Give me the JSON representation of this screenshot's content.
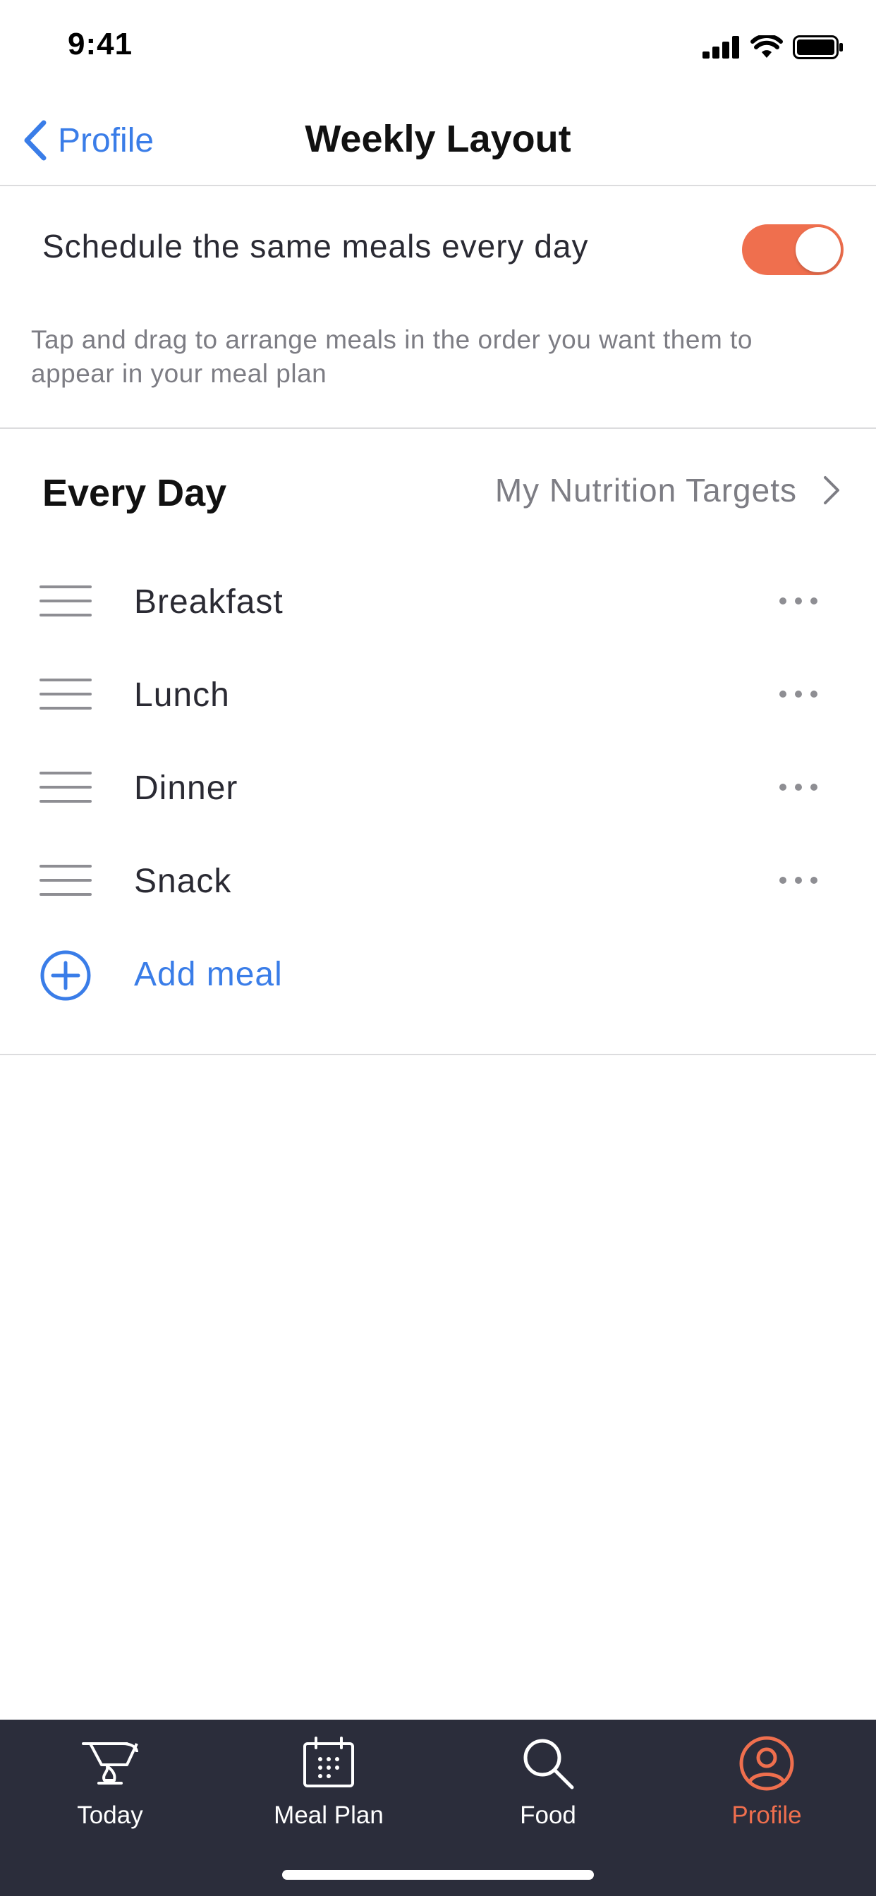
{
  "status_bar": {
    "time": "9:41"
  },
  "nav": {
    "back_label": "Profile",
    "title": "Weekly Layout"
  },
  "settings": {
    "same_meals_label": "Schedule the same meals every day",
    "same_meals_enabled": true,
    "help_text": "Tap and drag to arrange meals in the order you want them to appear in your meal plan"
  },
  "section": {
    "title": "Every Day",
    "targets_label": "My Nutrition Targets"
  },
  "meals": [
    {
      "name": "Breakfast"
    },
    {
      "name": "Lunch"
    },
    {
      "name": "Dinner"
    },
    {
      "name": "Snack"
    }
  ],
  "add_meal_label": "Add meal",
  "tabs": [
    {
      "label": "Today",
      "icon": "today-icon",
      "active": false
    },
    {
      "label": "Meal Plan",
      "icon": "calendar-icon",
      "active": false
    },
    {
      "label": "Food",
      "icon": "search-icon",
      "active": false
    },
    {
      "label": "Profile",
      "icon": "profile-icon",
      "active": true
    }
  ],
  "colors": {
    "accent": "#ef6f4e",
    "link": "#3a7de8",
    "tab_bar": "#2b2d3b"
  }
}
